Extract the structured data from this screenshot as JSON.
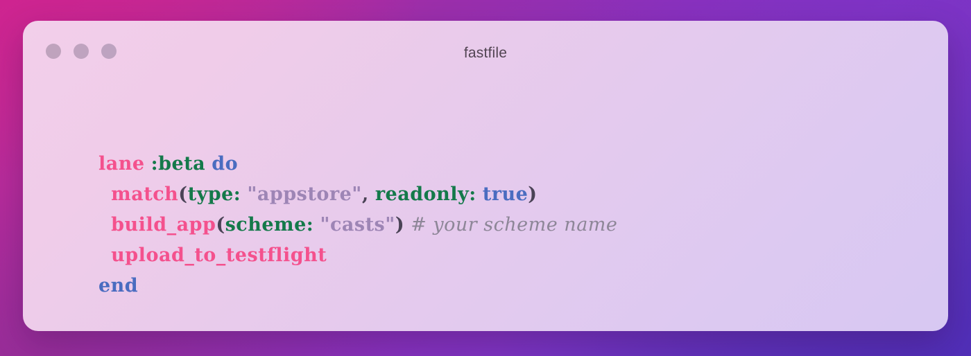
{
  "background": {
    "gradient_from": "#c92a93",
    "gradient_to": "#5633b4"
  },
  "window": {
    "title": "fastfile",
    "card_gradient_from": "#f2cfea",
    "card_gradient_to": "#d7c8f2",
    "controls": [
      {
        "name": "close",
        "color": "#bfa3bd"
      },
      {
        "name": "minimize",
        "color": "#bfa3bf"
      },
      {
        "name": "maximize",
        "color": "#bda3c0"
      }
    ]
  },
  "editor": {
    "language": "ruby",
    "colors": {
      "keyword": "#f4518d",
      "function": "#f4518d",
      "symbol": "#14794a",
      "label": "#14794a",
      "control": "#4a6cc0",
      "boolean": "#4a6cc0",
      "string": "#9d85b5",
      "punctuation": "#4a4356",
      "comment": "#8d8697"
    },
    "plain_text": "lane :beta do\n  match(type: \"appstore\", readonly: true)\n  build_app(scheme: \"casts\") # your scheme name\n  upload_to_testflight\nend",
    "lines": [
      {
        "indent": 0,
        "tokens": [
          {
            "t": "lane",
            "c": "tok-kw"
          },
          {
            "t": " ",
            "c": "tok-plain"
          },
          {
            "t": ":beta",
            "c": "tok-sym"
          },
          {
            "t": " ",
            "c": "tok-plain"
          },
          {
            "t": "do",
            "c": "tok-ctl"
          }
        ]
      },
      {
        "indent": 1,
        "tokens": [
          {
            "t": "match",
            "c": "tok-fn"
          },
          {
            "t": "(",
            "c": "tok-punc"
          },
          {
            "t": "type:",
            "c": "tok-label"
          },
          {
            "t": " ",
            "c": "tok-plain"
          },
          {
            "t": "\"appstore\"",
            "c": "tok-str"
          },
          {
            "t": ",",
            "c": "tok-punc"
          },
          {
            "t": " ",
            "c": "tok-plain"
          },
          {
            "t": "readonly:",
            "c": "tok-label"
          },
          {
            "t": " ",
            "c": "tok-plain"
          },
          {
            "t": "true",
            "c": "tok-bool"
          },
          {
            "t": ")",
            "c": "tok-punc"
          }
        ]
      },
      {
        "indent": 1,
        "tokens": [
          {
            "t": "build_app",
            "c": "tok-fn"
          },
          {
            "t": "(",
            "c": "tok-punc"
          },
          {
            "t": "scheme:",
            "c": "tok-label"
          },
          {
            "t": " ",
            "c": "tok-plain"
          },
          {
            "t": "\"casts\"",
            "c": "tok-str"
          },
          {
            "t": ")",
            "c": "tok-punc"
          },
          {
            "t": " ",
            "c": "tok-plain"
          },
          {
            "t": "# your scheme name",
            "c": "tok-comment"
          }
        ]
      },
      {
        "indent": 1,
        "tokens": [
          {
            "t": "upload_to_testflight",
            "c": "tok-fn"
          }
        ]
      },
      {
        "indent": 0,
        "tokens": [
          {
            "t": "end",
            "c": "tok-ctl"
          }
        ]
      }
    ]
  }
}
